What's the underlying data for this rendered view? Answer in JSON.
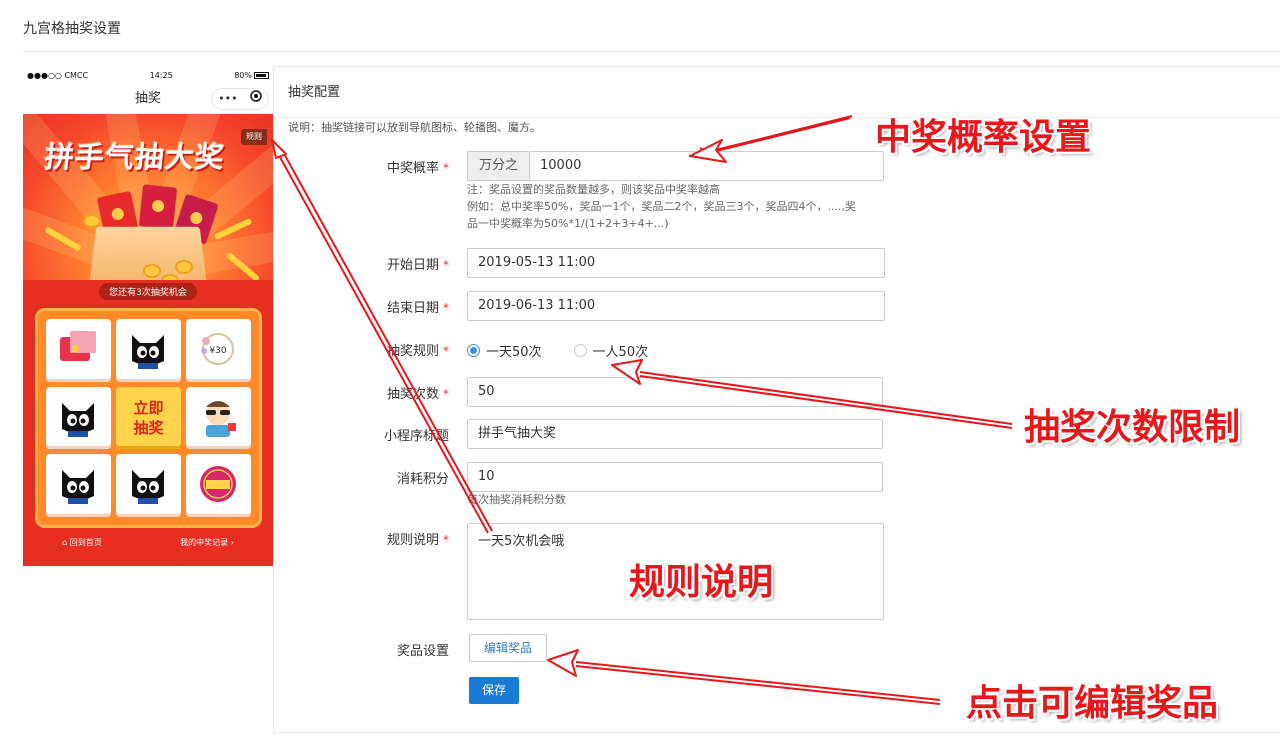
{
  "page": {
    "title": "九宫格抽奖设置"
  },
  "phone": {
    "status": {
      "carrier": "●●●○○ CMCC",
      "time": "14:25",
      "battery": "80%"
    },
    "nav_title": "抽奖",
    "capsule_more": "•••",
    "banner_title": "拼手气抽大奖",
    "rule_tag": "规则",
    "chances_text": "您还有3次抽奖机会",
    "draw_button": [
      "立即",
      "抽奖"
    ],
    "footer_home": "回到首页",
    "footer_records": "我的中奖记录"
  },
  "panel": {
    "title": "抽奖配置",
    "description": "说明：抽奖链接可以放到导航图标、轮播图、魔方。",
    "prob": {
      "label": "中奖概率",
      "addon": "万分之",
      "value": "10000",
      "help1": "注：奖品设置的奖品数量越多，则该奖品中奖率越高",
      "help2": "例如：总中奖率50%，奖品一1个，奖品二2个，奖品三3个，奖品四4个，....,奖",
      "help3": "品一中奖概率为50%*1/(1+2+3+4+...)"
    },
    "start": {
      "label": "开始日期",
      "value": "2019-05-13 11:00"
    },
    "end": {
      "label": "结束日期",
      "value": "2019-06-13 11:00"
    },
    "rule": {
      "label": "抽奖规则",
      "option1": "一天50次",
      "option2": "一人50次",
      "selected": "一天50次"
    },
    "count": {
      "label": "抽奖次数",
      "value": "50"
    },
    "mini_title": {
      "label": "小程序标题",
      "value": "拼手气抽大奖"
    },
    "points": {
      "label": "消耗积分",
      "value": "10",
      "help": "每次抽奖消耗积分数"
    },
    "rule_desc": {
      "label": "规则说明",
      "value": "一天5次机会哦"
    },
    "prize": {
      "label": "奖品设置",
      "button": "编辑奖品"
    },
    "save_button": "保存"
  },
  "annotations": {
    "prob": "中奖概率设置",
    "count": "抽奖次数限制",
    "rule": "规则说明",
    "prize": "点击可编辑奖品"
  },
  "colors": {
    "annotation": "#e8171b",
    "primary": "#1a7bd6",
    "required": "#e4393c",
    "link": "#337ab7"
  }
}
